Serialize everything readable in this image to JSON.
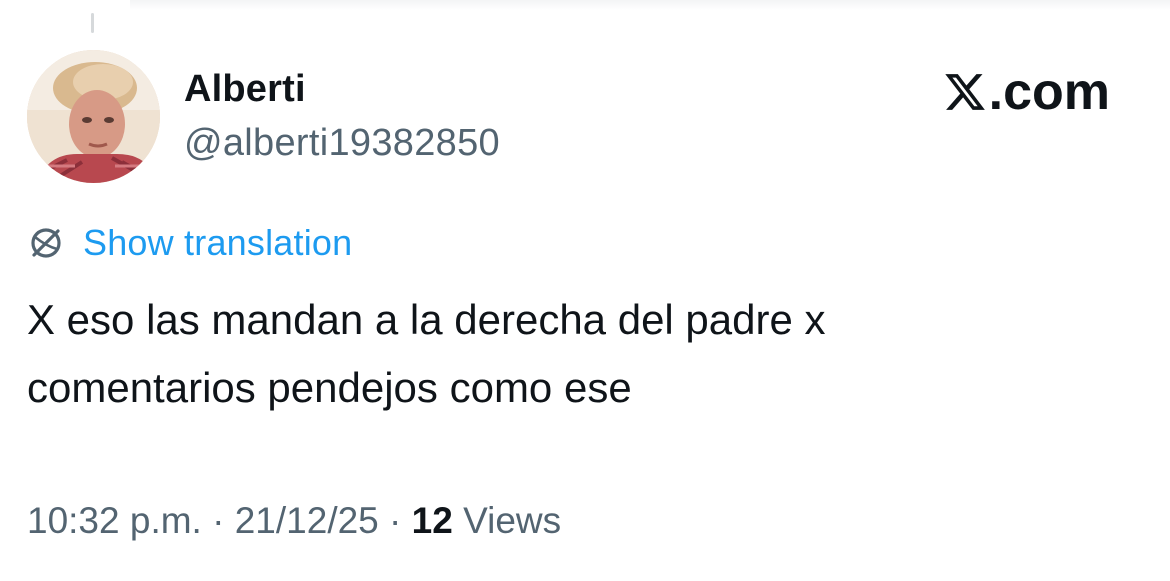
{
  "author": {
    "display_name": "Alberti",
    "handle": "@alberti19382850"
  },
  "brand": {
    "label": ".com",
    "icon": "x-logo-icon"
  },
  "translation": {
    "icon": "globe-icon",
    "label": "Show translation",
    "color": "#1d9bf0"
  },
  "tweet": {
    "text_line1": "X eso las mandan a la derecha del padre x",
    "text_line2": "comentarios pendejos como ese"
  },
  "meta": {
    "time": "10:32 p.m.",
    "separator": " · ",
    "date": "21/12/25",
    "views_count": "12",
    "views_label": "Views"
  },
  "colors": {
    "text_primary": "#0f1419",
    "text_secondary": "#536471",
    "link": "#1d9bf0",
    "background": "#ffffff"
  }
}
